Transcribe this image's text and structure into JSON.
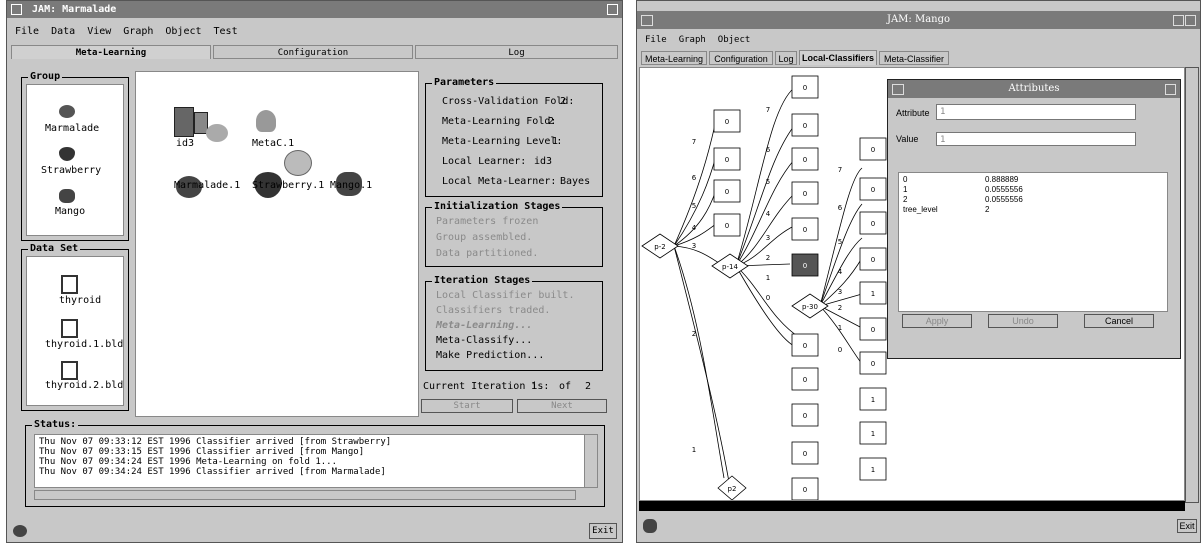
{
  "left": {
    "title": "JAM: Marmalade",
    "menu": [
      "File",
      "Data",
      "View",
      "Graph",
      "Object",
      "Test"
    ],
    "tabs": [
      "Meta-Learning",
      "Configuration",
      "Log"
    ],
    "group": {
      "label": "Group",
      "items": [
        "Marmalade",
        "Strawberry",
        "Mango"
      ]
    },
    "dataset": {
      "label": "Data Set",
      "items": [
        "thyroid",
        "thyroid.1.bld",
        "thyroid.2.bld"
      ]
    },
    "canvas_icons": [
      "id3",
      "MetaC.1",
      "Marmalade.1",
      "Strawberry.1",
      "Mango.1"
    ],
    "parameters": {
      "label": "Parameters",
      "rows": [
        {
          "name": "Cross-Validation Fold:",
          "value": "2"
        },
        {
          "name": "Meta-Learning Fold:",
          "value": "2"
        },
        {
          "name": "Meta-Learning Level:",
          "value": "1"
        },
        {
          "name": "Local Learner:",
          "value": "id3"
        },
        {
          "name": "Local Meta-Learner:",
          "value": "Bayes"
        }
      ]
    },
    "init": {
      "label": "Initialization Stages",
      "items": [
        "Parameters frozen",
        "Group assembled.",
        "Data partitioned."
      ]
    },
    "iter": {
      "label": "Iteration Stages",
      "items": [
        "Local Classifier built.",
        "Classifiers traded.",
        "Meta-Learning...",
        "Meta-Classify...",
        "Make Prediction..."
      ]
    },
    "current_iteration": {
      "label": "Current Iteration is:",
      "value": "1",
      "of": "of",
      "total": "2"
    },
    "start_label": "Start",
    "next_label": "Next",
    "status": {
      "label": "Status:",
      "lines": [
        "Thu Nov 07 09:33:12 EST 1996 Classifier arrived [from Strawberry]",
        "Thu Nov 07 09:33:15 EST 1996 Classifier arrived [from Mango]",
        "Thu Nov 07 09:34:24 EST 1996 Meta-Learning on fold 1...",
        "Thu Nov 07 09:34:24 EST 1996 Classifier arrived [from Marmalade]"
      ]
    },
    "exit_label": "Exit"
  },
  "right": {
    "title": "JAM: Mango",
    "menu": [
      "File",
      "Graph",
      "Object"
    ],
    "tabs": [
      "Meta-Learning",
      "Configuration",
      "Log",
      "Local-Classifiers",
      "Meta-Classifier"
    ],
    "graph": {
      "nodes": [
        "p-2",
        "p-14",
        "p-30",
        "p2"
      ],
      "leaf_value": "0",
      "leaf_value_alt": "1",
      "edge_labels": [
        "7",
        "6",
        "5",
        "4",
        "3",
        "2",
        "1",
        "0"
      ]
    },
    "dialog": {
      "title": "Attributes",
      "attribute_label": "Attribute",
      "attribute_value": "1",
      "value_label": "Value",
      "value_value": "1",
      "list": [
        {
          "key": "0",
          "val": "0.888889"
        },
        {
          "key": "1",
          "val": "0.0555556"
        },
        {
          "key": "2",
          "val": "0.0555556"
        },
        {
          "key": "tree_level",
          "val": "2"
        }
      ],
      "apply_label": "Apply",
      "undo_label": "Undo",
      "cancel_label": "Cancel"
    },
    "exit_label": "Exit"
  }
}
